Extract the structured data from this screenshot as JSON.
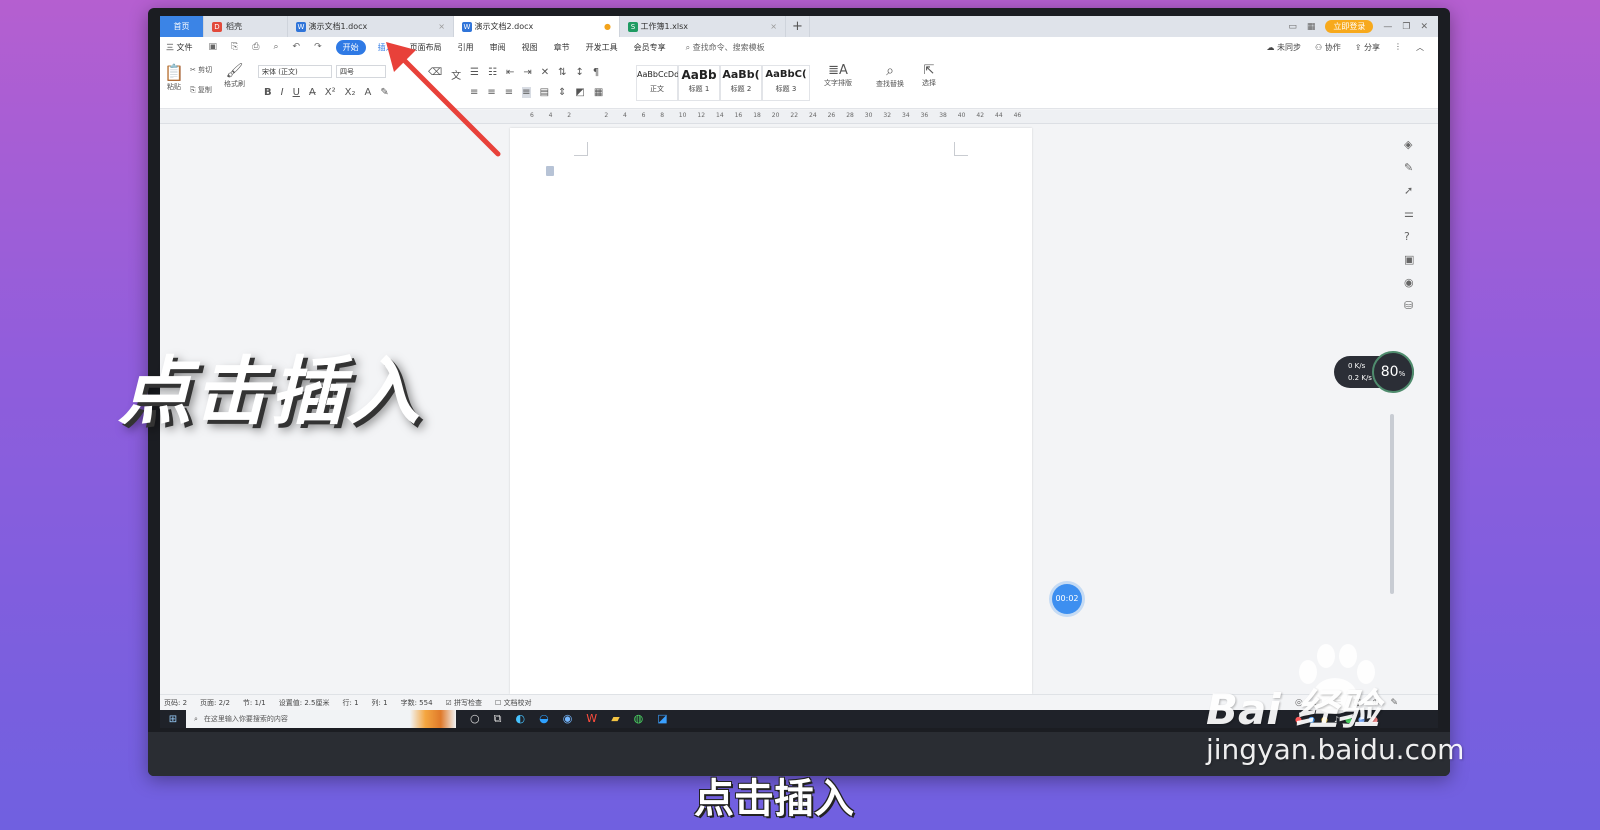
{
  "tabs": {
    "home": "首页",
    "shell": "稻壳",
    "doc1": "演示文档1.docx",
    "doc2": "演示文档2.docx",
    "sheet": "工作簿1.xlsx",
    "add": "+"
  },
  "topright": {
    "login": "立即登录"
  },
  "menu": {
    "file": "三 文件",
    "start": "开始",
    "insert": "插入",
    "layout": "页面布局",
    "references": "引用",
    "review": "审阅",
    "view": "视图",
    "section": "章节",
    "devtools": "开发工具",
    "member": "会员专享",
    "search": "查找命令、搜索模板",
    "unsync": "未同步",
    "collab": "协作",
    "share": "分享"
  },
  "ribbon": {
    "paste": "粘贴",
    "cut": "剪切",
    "copy": "复制",
    "format_painter": "格式刷",
    "font_name": "宋体 (正文)",
    "font_size": "四号",
    "styles": [
      {
        "sample": "AaBbCcDd",
        "label": "正文"
      },
      {
        "sample": "AaBb",
        "label": "标题 1"
      },
      {
        "sample": "AaBb(",
        "label": "标题 2"
      },
      {
        "sample": "AaBbC(",
        "label": "标题 3"
      }
    ],
    "text_layout": "文字排版",
    "find_replace": "查找替换",
    "select": "选择"
  },
  "ruler_ticks": [
    "6",
    "4",
    "2",
    "",
    "2",
    "4",
    "6",
    "8",
    "10",
    "12",
    "14",
    "16",
    "18",
    "20",
    "22",
    "24",
    "26",
    "28",
    "30",
    "32",
    "34",
    "36",
    "38",
    "40",
    "42",
    "44",
    "46"
  ],
  "timer": "00:02",
  "net": {
    "up": "0 K/s",
    "down": "0.2 K/s",
    "percent": "80",
    "unit": "%"
  },
  "status": {
    "page_num": "页码: 2",
    "pages": "页面: 2/2",
    "section": "节: 1/1",
    "setting": "设置值: 2.5厘米",
    "row": "行: 1",
    "col": "列: 1",
    "words": "字数: 554",
    "spell": "拼写检查",
    "proof": "文档校对"
  },
  "taskbar": {
    "search_placeholder": "在这里输入你要搜索的内容"
  },
  "overlay": {
    "title": "点击插入",
    "caption": "点击插入"
  },
  "watermark": {
    "logo": "Bai 经验",
    "url": "jingyan.baidu.com"
  },
  "colors": {
    "accent": "#2f7ae5",
    "arrow": "#e8413a",
    "background": "#9a5fd8"
  }
}
